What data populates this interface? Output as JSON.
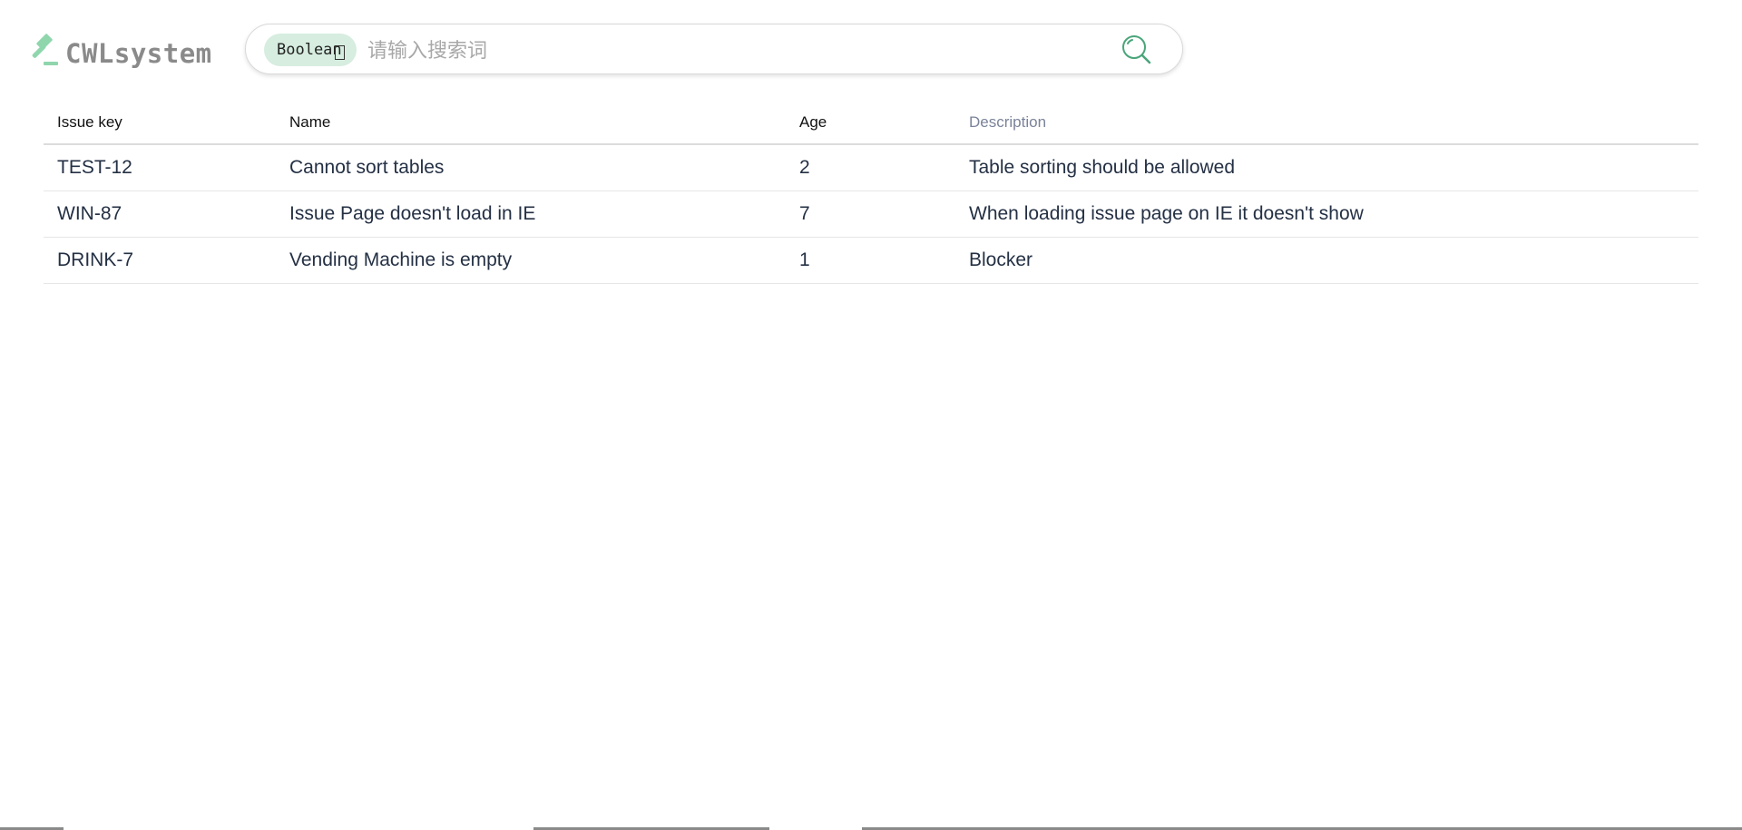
{
  "app": {
    "logo_text": "CWLsystem",
    "logo_icon": "gavel-icon",
    "accent_color": "#7fd3a4"
  },
  "search": {
    "mode_label": "Boolean",
    "placeholder": "请输入搜索词",
    "value": "",
    "search_icon": "search-icon"
  },
  "table": {
    "columns": [
      "Issue key",
      "Name",
      "Age",
      "Description"
    ],
    "rows": [
      {
        "key": "TEST-12",
        "name": "Cannot sort tables",
        "age": "2",
        "description": "Table sorting should be allowed"
      },
      {
        "key": "WIN-87",
        "name": "Issue Page doesn't load in IE",
        "age": "7",
        "description": "When loading issue page on IE it doesn't show"
      },
      {
        "key": "DRINK-7",
        "name": "Vending Machine is empty",
        "age": "1",
        "description": "Blocker"
      }
    ]
  }
}
